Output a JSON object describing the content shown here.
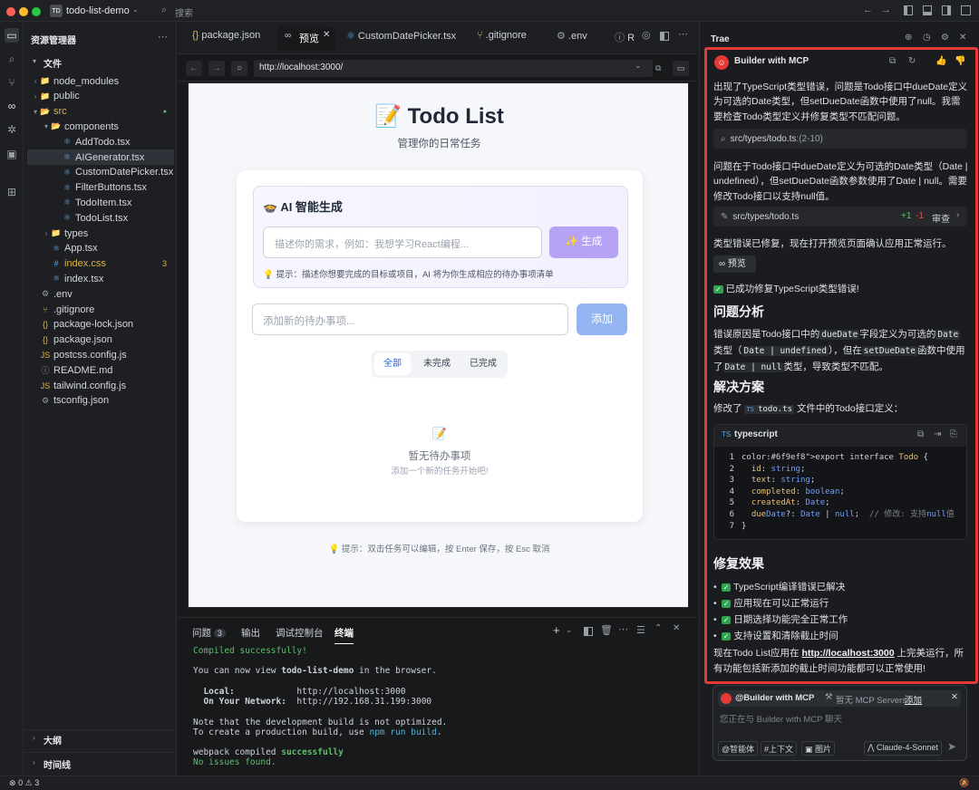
{
  "titlebar": {
    "project_badge": "TD",
    "project": "todo-list-demo",
    "search": "搜索"
  },
  "explorer": {
    "title": "资源管理器",
    "section": "文件",
    "outline": "大纲",
    "timeline": "时间线",
    "items": [
      {
        "label": "node_modules",
        "type": "folder",
        "depth": 1
      },
      {
        "label": "public",
        "type": "folder",
        "depth": 1
      },
      {
        "label": "src",
        "type": "folder-open",
        "depth": 1,
        "status": "●"
      },
      {
        "label": "components",
        "type": "folder-open",
        "depth": 2
      },
      {
        "label": "AddTodo.tsx",
        "type": "react",
        "depth": 3
      },
      {
        "label": "AIGenerator.tsx",
        "type": "react",
        "depth": 3
      },
      {
        "label": "CustomDatePicker.tsx",
        "type": "react",
        "depth": 3
      },
      {
        "label": "FilterButtons.tsx",
        "type": "react",
        "depth": 3
      },
      {
        "label": "TodoItem.tsx",
        "type": "react",
        "depth": 3
      },
      {
        "label": "TodoList.tsx",
        "type": "react",
        "depth": 3
      },
      {
        "label": "types",
        "type": "folder",
        "depth": 2
      },
      {
        "label": "App.tsx",
        "type": "react",
        "depth": 2
      },
      {
        "label": "index.css",
        "type": "css",
        "depth": 2,
        "badge": "3"
      },
      {
        "label": "index.tsx",
        "type": "react",
        "depth": 2
      },
      {
        "label": ".env",
        "type": "gear",
        "depth": 1
      },
      {
        "label": ".gitignore",
        "type": "git",
        "depth": 1
      },
      {
        "label": "package-lock.json",
        "type": "json",
        "depth": 1
      },
      {
        "label": "package.json",
        "type": "json",
        "depth": 1
      },
      {
        "label": "postcss.config.js",
        "type": "js",
        "depth": 1
      },
      {
        "label": "README.md",
        "type": "info",
        "depth": 1
      },
      {
        "label": "tailwind.config.js",
        "type": "js",
        "depth": 1
      },
      {
        "label": "tsconfig.json",
        "type": "gear",
        "depth": 1
      }
    ]
  },
  "tabs": [
    "package.json",
    "预览",
    "CustomDatePicker.tsx",
    ".gitignore",
    ".env",
    "R"
  ],
  "browser": {
    "url": "http://localhost:3000/"
  },
  "app": {
    "title": "📝 Todo List",
    "subtitle": "管理你的日常任务",
    "ai_title": "🍲 AI 智能生成",
    "ai_placeholder": "描述你的需求，例如：我想学习React编程...",
    "ai_button": "✨ 生成",
    "ai_hint": "💡 提示：描述你想要完成的目标或项目，AI 将为你生成相应的待办事项清单",
    "add_placeholder": "添加新的待办事项...",
    "add_button": "添加",
    "filters": [
      "全部",
      "未完成",
      "已完成"
    ],
    "empty_icon": "📝",
    "empty_title": "暂无待办事项",
    "empty_sub": "添加一个新的任务开始吧!",
    "footer": "💡 提示：双击任务可以编辑，按 Enter 保存，按 Esc 取消"
  },
  "terminal": {
    "tabs": [
      "问题",
      "输出",
      "调试控制台",
      "终端"
    ],
    "problems_count": "3",
    "compiled": "Compiled successfully!",
    "view_pre": "You can now view ",
    "view_app": "todo-list-demo",
    "view_post": " in the browser.",
    "local_label": "Local:",
    "local_url": "http://localhost:3000",
    "net_label": "On Your Network:",
    "net_url": "http://192.168.31.199:3000",
    "note1": "Note that the development build is not optimized.",
    "note2_pre": "To create a production build, use ",
    "note2_cmd": "npm run build",
    "note2_post": ".",
    "wp_pre": "webpack compiled ",
    "wp_ok": "successfully",
    "no_issues": "No issues found."
  },
  "panel": {
    "title": "Trae",
    "agent": "Builder with MCP",
    "p1": "出现了TypeScript类型错误，问题是Todo接口中dueDate定义为可选的Date类型，但setDueDate函数中使用了null。我需要检查Todo类型定义并修复类型不匹配问题。",
    "file1": "src/types/todo.ts",
    "file1_range": ":(2-10)",
    "p2": "问题在于Todo接口中dueDate定义为可选的Date类型（Date | undefined），但setDueDate函数参数使用了Date | null。需要修改Todo接口以支持null值。",
    "file2": "src/types/todo.ts",
    "file2_add": "+1",
    "file2_del": "-1",
    "file2_review": "审查",
    "p3": "类型错误已修复，现在打开预览页面确认应用正常运行。",
    "preview_btn": "预览",
    "success": "已成功修复TypeScript类型错误!",
    "h_analysis": "问题分析",
    "p4_a": "错误原因是Todo接口中的",
    "p4_b": "dueDate",
    "p4_c": "字段定义为可选的",
    "p4_d": "Date",
    "p4_e": "类型（",
    "p4_f": "Date | undefined",
    "p4_g": "），但在",
    "p4_h": "setDueDate",
    "p4_i": "函数中使用了",
    "p4_j": "Date | null",
    "p4_k": "类型，导致类型不匹配。",
    "h_solution": "解决方案",
    "p5_a": "修改了",
    "p5_file": "todo.ts",
    "p5_b": "文件中的Todo接口定义：",
    "code_lang": "typescript",
    "code": [
      {
        "n": "1",
        "t": "export interface Todo {"
      },
      {
        "n": "2",
        "t": "  id: string;"
      },
      {
        "n": "3",
        "t": "  text: string;"
      },
      {
        "n": "4",
        "t": "  completed: boolean;"
      },
      {
        "n": "5",
        "t": "  createdAt: Date;"
      },
      {
        "n": "6",
        "t": "  dueDate?: Date | null;  // 修改: 支持null值"
      },
      {
        "n": "7",
        "t": "}"
      }
    ],
    "h_effect": "修复效果",
    "effects": [
      "TypeScript编译错误已解决",
      "应用现在可以正常运行",
      "日期选择功能完全正常工作",
      "支持设置和清除截止时间"
    ],
    "p6_a": "现在Todo List应用在 ",
    "p6_url": "http://localhost:3000",
    "p6_b": " 上完美运行，所有功能包括新添加的截止时间功能都可以正常使用!",
    "input_agent": "@Builder with MCP",
    "input_mcp": "暂无 MCP Servers",
    "input_add": "添加",
    "input_placeholder": "您正在与 Builder with MCP 聊天",
    "btn_agent": "智能体",
    "btn_ctx": "上下文",
    "btn_img": "图片",
    "model": "Claude-4-Sonnet"
  },
  "status": {
    "errors": "0",
    "warnings": "3"
  },
  "colors": {
    "highlight": "#e53935",
    "primary": "#4f8df5",
    "ai_button": "#b6a3f5"
  }
}
